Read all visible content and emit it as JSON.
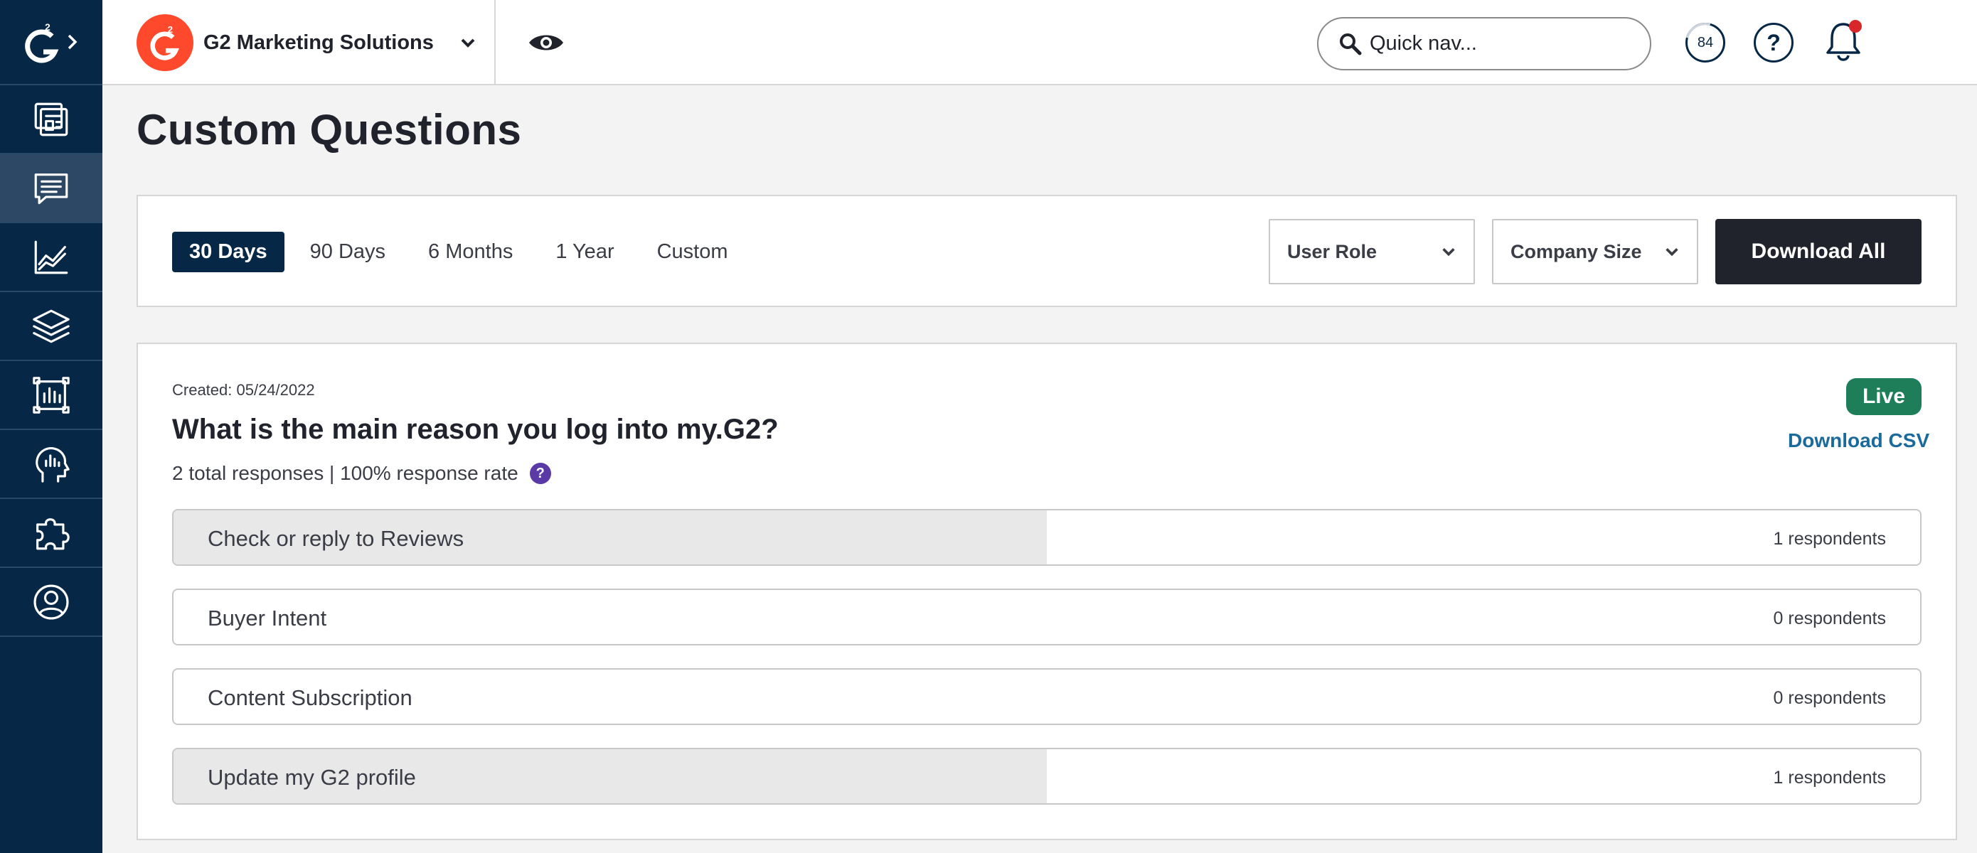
{
  "sidebar": {
    "logo": "G2",
    "items": [
      {
        "icon": "dashboard-icon"
      },
      {
        "icon": "chat-icon",
        "active": true
      },
      {
        "icon": "chart-line-icon"
      },
      {
        "icon": "layers-icon"
      },
      {
        "icon": "bar-report-icon"
      },
      {
        "icon": "head-insights-icon"
      },
      {
        "icon": "puzzle-icon"
      },
      {
        "icon": "user-circle-icon"
      }
    ]
  },
  "topbar": {
    "brand_name": "G2 Marketing Solutions",
    "search_placeholder": "Quick nav...",
    "score": "84",
    "help": "?",
    "accent_color": "#ff492c"
  },
  "page": {
    "title": "Custom Questions"
  },
  "filters": {
    "ranges": [
      "30 Days",
      "90 Days",
      "6 Months",
      "1 Year",
      "Custom"
    ],
    "active_range": "30 Days",
    "user_role": "User Role",
    "company_size": "Company Size",
    "download_all": "Download All"
  },
  "question": {
    "created": "Created: 05/24/2022",
    "text": "What is the main reason you log into my.G2?",
    "responses": "2 total responses | 100% response rate",
    "info": "?",
    "status": "Live",
    "download_csv": "Download CSV",
    "answers": [
      {
        "label": "Check or reply to Reviews",
        "count": "1 respondents",
        "share": 0.5
      },
      {
        "label": "Buyer Intent",
        "count": "0 respondents",
        "share": 0
      },
      {
        "label": "Content Subscription",
        "count": "0 respondents",
        "share": 0
      },
      {
        "label": "Update my G2 profile",
        "count": "1 respondents",
        "share": 0.5
      }
    ]
  }
}
